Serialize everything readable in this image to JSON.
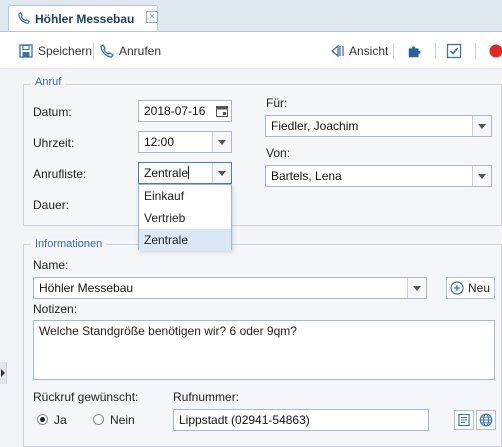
{
  "tab": {
    "title": "Höhler Messebau"
  },
  "toolbar": {
    "save": "Speichern",
    "call": "Anrufen",
    "view": "Ansicht"
  },
  "anruf": {
    "legend": "Anruf",
    "date_label": "Datum:",
    "date_value": "2018-07-16",
    "time_label": "Uhrzeit:",
    "time_value": "12:00",
    "list_label": "Anrufliste:",
    "list_value": "Zentrale",
    "duration_label": "Dauer:",
    "list_options": [
      "Einkauf",
      "Vertrieb",
      "Zentrale"
    ],
    "for_label": "Für:",
    "for_value": "Fiedler, Joachim",
    "from_label": "Von:",
    "from_value": "Bartels, Lena"
  },
  "info": {
    "legend": "Informationen",
    "name_label": "Name:",
    "name_value": "Höhler Messebau",
    "new_button": "Neu",
    "notes_label": "Notizen:",
    "notes_value": "Welche Standgröße benötigen wir? 6 oder 9qm?",
    "callback_label": "Rückruf gewünscht:",
    "yes": "Ja",
    "no": "Nein",
    "phone_label": "Rufnummer:",
    "phone_value": "Lippstadt (02941-54863)"
  }
}
